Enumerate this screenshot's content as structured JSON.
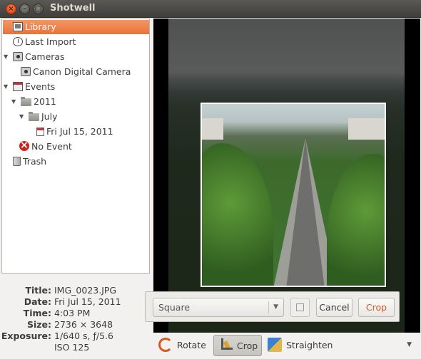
{
  "window": {
    "title": "Shotwell"
  },
  "sidebar": {
    "items": [
      {
        "label": "Library"
      },
      {
        "label": "Last Import"
      },
      {
        "label": "Cameras"
      },
      {
        "label": "Canon Digital Camera"
      },
      {
        "label": "Events"
      },
      {
        "label": "2011"
      },
      {
        "label": "July"
      },
      {
        "label": "Fri Jul 15, 2011"
      },
      {
        "label": "No Event"
      },
      {
        "label": "Trash"
      }
    ]
  },
  "metadata": {
    "title_key": "Title:",
    "title": "IMG_0023.JPG",
    "date_key": "Date:",
    "date": "Fri Jul 15, 2011",
    "time_key": "Time:",
    "time": "4:03 PM",
    "size_key": "Size:",
    "size": "2736 × 3648",
    "exposure_key": "Exposure:",
    "exposure": "1/640 s, ƒ/5.6",
    "iso": "ISO 125"
  },
  "crop_toolbar": {
    "aspect_selected": "Square",
    "cancel_label": "Cancel",
    "crop_label": "Crop"
  },
  "toolbar": {
    "rotate_label": "Rotate",
    "crop_label": "Crop",
    "straighten_label": "Straighten"
  },
  "icons": {
    "close": "close-icon",
    "minimize": "minimize-icon",
    "maximize": "maximize-icon",
    "rotate": "rotate-icon",
    "crop": "crop-icon",
    "straighten": "straighten-icon"
  },
  "colors": {
    "selection": "#e9733b",
    "accent": "#d05b2c"
  }
}
